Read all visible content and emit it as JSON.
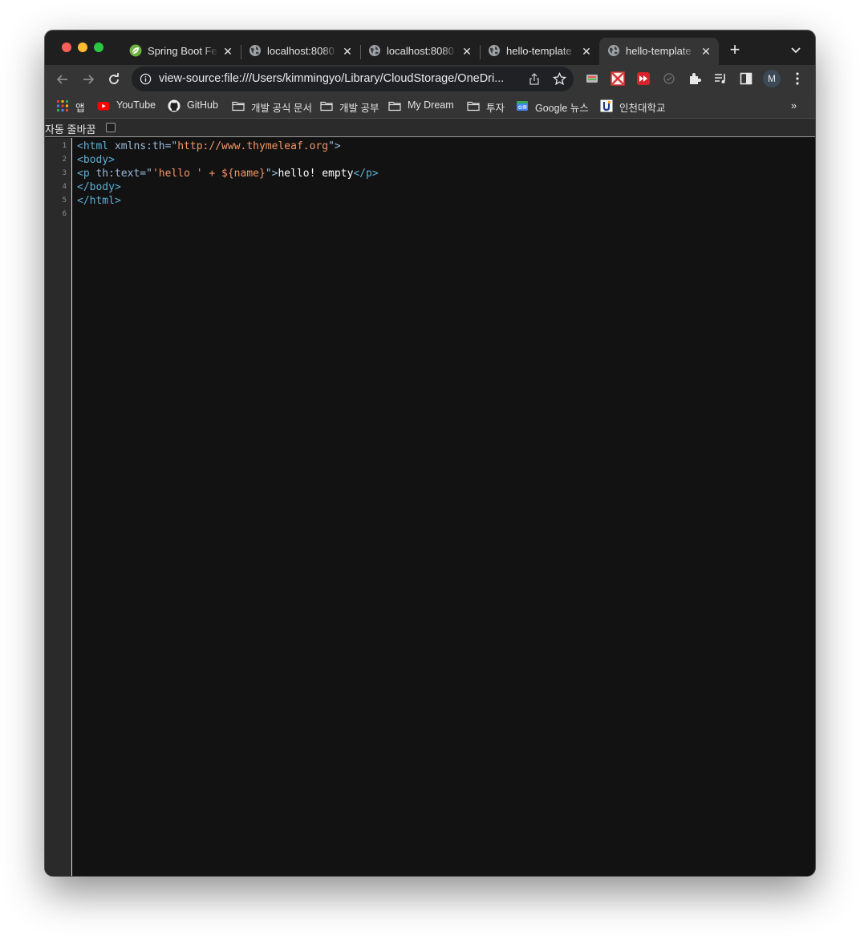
{
  "tabs": [
    {
      "title": "Spring Boot Features",
      "favicon": "spring-leaf-icon",
      "active": false
    },
    {
      "title": "localhost:8080",
      "favicon": "globe-icon",
      "active": false
    },
    {
      "title": "localhost:8080",
      "favicon": "globe-icon",
      "active": false
    },
    {
      "title": "hello-template",
      "favicon": "globe-icon",
      "active": false
    },
    {
      "title": "hello-template",
      "favicon": "globe-icon",
      "active": true
    }
  ],
  "toolbar": {
    "url": "view-source:file:///Users/kimmingyo/Library/CloudStorage/OneDri...",
    "profile_initial": "M"
  },
  "bookmarks": [
    {
      "label": "앱",
      "icon": "apps-grid-icon"
    },
    {
      "label": "YouTube",
      "icon": "youtube-icon"
    },
    {
      "label": "GitHub",
      "icon": "github-icon"
    },
    {
      "label": "개발 공식 문서",
      "icon": "folder-icon"
    },
    {
      "label": "개발 공부",
      "icon": "folder-icon"
    },
    {
      "label": "My Dream",
      "icon": "folder-icon"
    },
    {
      "label": "투자",
      "icon": "folder-icon"
    },
    {
      "label": "Google 뉴스",
      "icon": "google-news-icon"
    },
    {
      "label": "인천대학교",
      "icon": "university-icon"
    }
  ],
  "wrap": {
    "label": "자동 줄바꿈",
    "checked": false
  },
  "source": {
    "line_numbers": [
      "1",
      "2",
      "3",
      "4",
      "5",
      "6"
    ],
    "line1": {
      "open": "<html ",
      "attr": "xmlns:th=\"",
      "val": "http://www.thymeleaf.org",
      "close": "\">"
    },
    "line2": {
      "open": "<body>"
    },
    "line3": {
      "open": "<p ",
      "attr": "th:text=\"",
      "val": "'hello ' + ${name}",
      "close": "\">",
      "text": "hello! empty",
      "end": "</p>"
    },
    "line4": {
      "open": "</body>"
    },
    "line5": {
      "open": "</html>"
    }
  },
  "colors": {
    "tag": "#5db0d7",
    "attribute": "#9bbbdc",
    "value": "#f29766",
    "text": "#ffffff",
    "background": "#121212"
  }
}
